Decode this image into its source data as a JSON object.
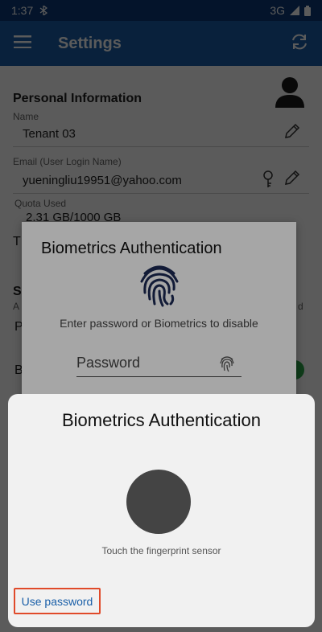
{
  "status_bar": {
    "time": "1:37",
    "network": "3G"
  },
  "app_bar": {
    "title": "Settings"
  },
  "settings": {
    "personal_section_title": "Personal Information",
    "name_label": "Name",
    "name_value": "Tenant 03",
    "email_label": "Email (User Login Name)",
    "email_value": "yueningliu19951@yahoo.com",
    "quota_label": "Quota Used",
    "quota_value": "2.31 GB/1000 GB",
    "partial_T": "T",
    "partial_S": "S",
    "partial_A": "A",
    "partial_P": "P",
    "partial_B": "B",
    "partial_right_d": "d"
  },
  "dialog": {
    "title": "Biometrics Authentication",
    "message": "Enter password or Biometrics to disable",
    "password_placeholder": "Password"
  },
  "bottom_sheet": {
    "title": "Biometrics Authentication",
    "sensor_text": "Touch the fingerprint sensor",
    "use_password": "Use password"
  },
  "colors": {
    "status_bar": "#0d3a78",
    "app_bar": "#1a5fa8",
    "toggle": "#2aa84a",
    "highlight": "#e04a2a"
  }
}
